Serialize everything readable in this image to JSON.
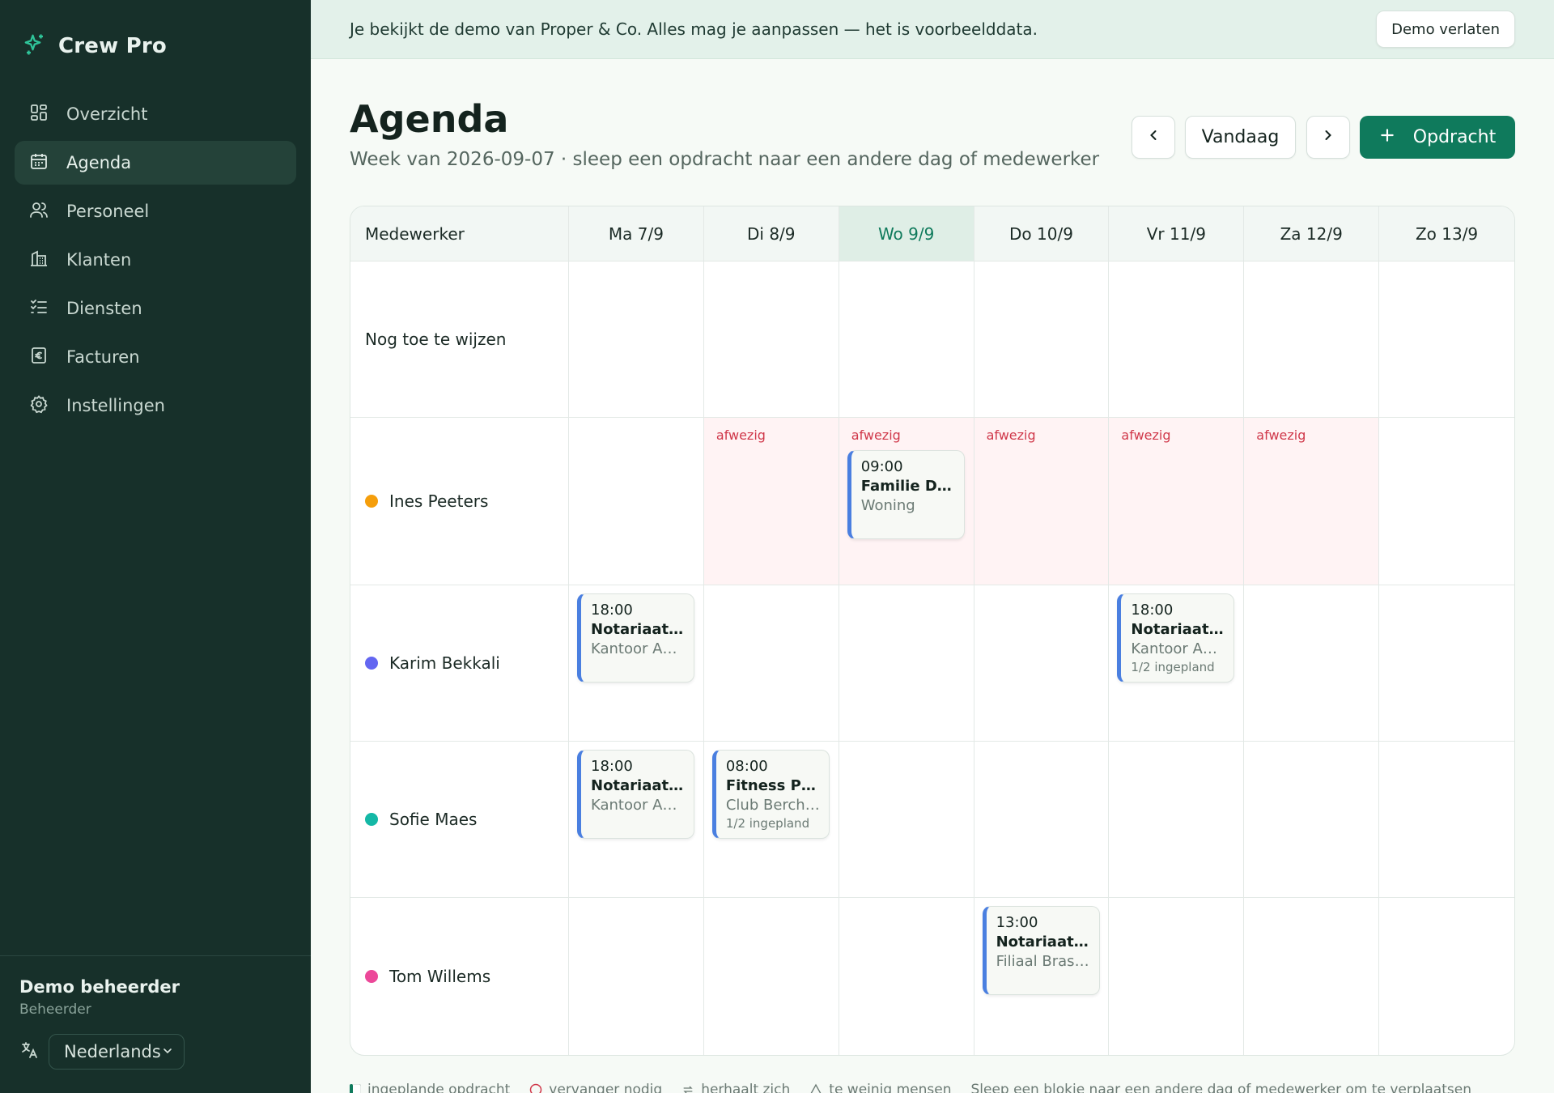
{
  "app": {
    "name": "Crew Pro"
  },
  "nav": [
    {
      "label": "Overzicht",
      "icon": "dashboard-icon",
      "active": false
    },
    {
      "label": "Agenda",
      "icon": "calendar-icon",
      "active": true
    },
    {
      "label": "Personeel",
      "icon": "users-icon",
      "active": false
    },
    {
      "label": "Klanten",
      "icon": "building-icon",
      "active": false
    },
    {
      "label": "Diensten",
      "icon": "checklist-icon",
      "active": false
    },
    {
      "label": "Facturen",
      "icon": "invoice-euro-icon",
      "active": false
    },
    {
      "label": "Instellingen",
      "icon": "gear-icon",
      "active": false
    }
  ],
  "user": {
    "name": "Demo beheerder",
    "role": "Beheerder",
    "language": "Nederlands"
  },
  "banner": {
    "text": "Je bekijkt de demo van Proper & Co. Alles mag je aanpassen — het is voorbeelddata.",
    "button": "Demo verlaten"
  },
  "header": {
    "title": "Agenda",
    "subtitle": "Week van 2026-09-07 · sleep een opdracht naar een andere dag of medewerker",
    "today_button": "Vandaag",
    "add_button": "Opdracht"
  },
  "grid": {
    "first_column": "Medewerker",
    "days": [
      {
        "label": "Ma 7/9",
        "today": false
      },
      {
        "label": "Di 8/9",
        "today": false
      },
      {
        "label": "Wo 9/9",
        "today": true
      },
      {
        "label": "Do 10/9",
        "today": false
      },
      {
        "label": "Vr 11/9",
        "today": false
      },
      {
        "label": "Za 12/9",
        "today": false
      },
      {
        "label": "Zo 13/9",
        "today": false
      }
    ],
    "absent_label": "afwezig",
    "rows": [
      {
        "name": "Nog toe te wijzen",
        "color": "",
        "absent_days": [],
        "jobs": []
      },
      {
        "name": "Ines Peeters",
        "color": "#f59e0b",
        "absent_days": [
          1,
          2,
          3,
          4,
          5
        ],
        "jobs": [
          {
            "day": 2,
            "time": "09:00",
            "name": "Familie De S...",
            "location": "Woning",
            "planned": ""
          }
        ]
      },
      {
        "name": "Karim Bekkali",
        "color": "#6366f1",
        "absent_days": [],
        "jobs": [
          {
            "day": 0,
            "time": "18:00",
            "name": "Notariaat V...",
            "location": "Kantoor Ant...",
            "planned": ""
          },
          {
            "day": 4,
            "time": "18:00",
            "name": "Notariaat V...",
            "location": "Kantoor Ant...",
            "planned": "1/2 ingepland"
          }
        ]
      },
      {
        "name": "Sofie Maes",
        "color": "#14b8a6",
        "absent_days": [],
        "jobs": [
          {
            "day": 0,
            "time": "18:00",
            "name": "Notariaat V...",
            "location": "Kantoor Ant...",
            "planned": ""
          },
          {
            "day": 1,
            "time": "08:00",
            "name": "Fitness Puls",
            "location": "Club Berche...",
            "planned": "1/2 ingepland"
          }
        ]
      },
      {
        "name": "Tom Willems",
        "color": "#ec4899",
        "absent_days": [],
        "jobs": [
          {
            "day": 3,
            "time": "13:00",
            "name": "Notariaat V...",
            "location": "Filiaal Brass...",
            "planned": ""
          }
        ]
      }
    ]
  },
  "legend": {
    "items": [
      "ingeplande opdracht",
      "vervanger nodig",
      "herhaalt zich",
      "te weinig mensen"
    ],
    "hint": "Sleep een blokje naar een andere dag of medewerker om te verplaatsen"
  },
  "colors": {
    "accent": "#0f7a5c",
    "sidebar": "#17302a",
    "card_border": "#4a7fe0",
    "absent": "#d0384a"
  }
}
